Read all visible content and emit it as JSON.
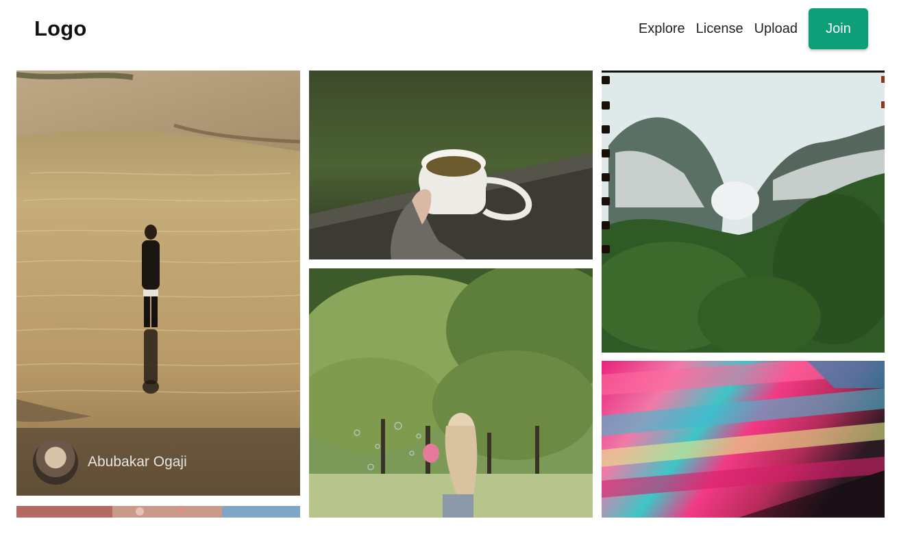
{
  "header": {
    "logo": "Logo",
    "nav": {
      "explore": "Explore",
      "license": "License",
      "upload": "Upload",
      "join": "Join"
    }
  },
  "brand_color": "#0e9e78",
  "gallery": {
    "featured_author": "Abubakar Ogaji"
  }
}
